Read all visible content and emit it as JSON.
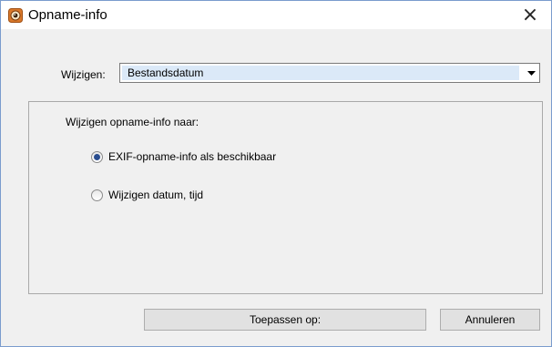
{
  "window": {
    "title": "Opname-info",
    "close_symbol": "×"
  },
  "change": {
    "label": "Wijzigen:",
    "selected_value": "Bestandsdatum"
  },
  "group": {
    "label": "Wijzigen opname-info naar:",
    "options": [
      {
        "label": "EXIF-opname-info als beschikbaar",
        "checked": true
      },
      {
        "label": "Wijzigen datum, tijd",
        "checked": false
      }
    ]
  },
  "buttons": {
    "apply_label": "Toepassen op:",
    "cancel_label": "Annuleren"
  },
  "icons": {
    "app": "app-icon",
    "close": "close-icon",
    "dropdown": "chevron-down-icon"
  }
}
